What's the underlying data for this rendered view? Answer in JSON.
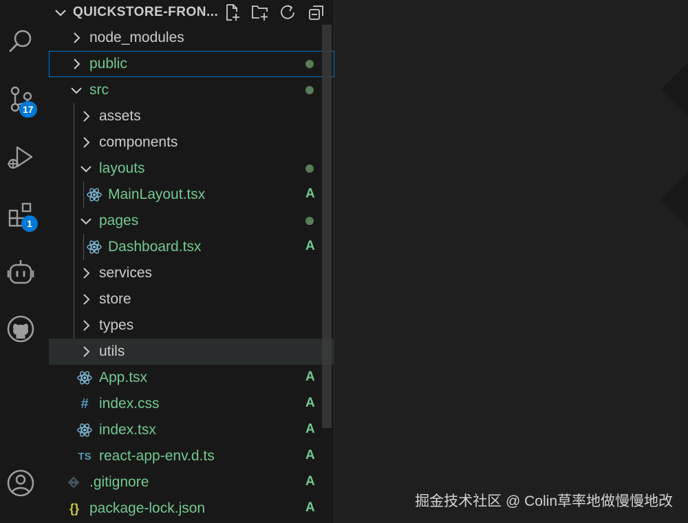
{
  "explorer": {
    "title": "QUICKSTORE-FRON...",
    "actions": [
      {
        "icon": "new-file-icon"
      },
      {
        "icon": "new-folder-icon"
      },
      {
        "icon": "refresh-icon"
      },
      {
        "icon": "collapse-all-icon"
      }
    ],
    "tree": [
      {
        "label": "node_modules",
        "kind": "folder",
        "expanded": false,
        "status": ""
      },
      {
        "label": "public",
        "kind": "folder",
        "expanded": false,
        "status": "dot",
        "selected": true
      },
      {
        "label": "src",
        "kind": "folder",
        "expanded": true,
        "status": "dot"
      },
      {
        "label": "assets",
        "kind": "folder",
        "expanded": false,
        "status": ""
      },
      {
        "label": "components",
        "kind": "folder",
        "expanded": false,
        "status": ""
      },
      {
        "label": "layouts",
        "kind": "folder",
        "expanded": true,
        "status": "dot"
      },
      {
        "label": "MainLayout.tsx",
        "kind": "react",
        "status": "A"
      },
      {
        "label": "pages",
        "kind": "folder",
        "expanded": true,
        "status": "dot"
      },
      {
        "label": "Dashboard.tsx",
        "kind": "react",
        "status": "A"
      },
      {
        "label": "services",
        "kind": "folder",
        "expanded": false,
        "status": ""
      },
      {
        "label": "store",
        "kind": "folder",
        "expanded": false,
        "status": ""
      },
      {
        "label": "types",
        "kind": "folder",
        "expanded": false,
        "status": ""
      },
      {
        "label": "utils",
        "kind": "folder",
        "expanded": false,
        "status": "",
        "hovered": true
      },
      {
        "label": "App.tsx",
        "kind": "react",
        "status": "A"
      },
      {
        "label": "index.css",
        "kind": "css",
        "icon_text": "#",
        "status": "A"
      },
      {
        "label": "index.tsx",
        "kind": "react",
        "status": "A"
      },
      {
        "label": "react-app-env.d.ts",
        "kind": "ts",
        "icon_text": "TS",
        "status": "A"
      },
      {
        "label": ".gitignore",
        "kind": "git",
        "status": "A"
      },
      {
        "label": "package-lock.json",
        "kind": "json",
        "icon_text": "{}",
        "status": "A"
      }
    ]
  },
  "activity_bar": {
    "items": [
      {
        "icon": "search-icon"
      },
      {
        "icon": "source-control-icon",
        "badge": "17"
      },
      {
        "icon": "run-debug-icon"
      },
      {
        "icon": "extensions-icon",
        "badge": "1"
      },
      {
        "icon": "copilot-icon"
      },
      {
        "icon": "github-icon"
      },
      {
        "icon": "account-icon"
      }
    ]
  },
  "watermark": "掘金技术社区 @ Colin草率地做慢慢地改",
  "colors": {
    "accent": "#0078d4",
    "added": "#73c991",
    "modified_dot": "#587c58",
    "sidebar_bg": "#181818",
    "editor_bg": "#1f1f1f"
  }
}
